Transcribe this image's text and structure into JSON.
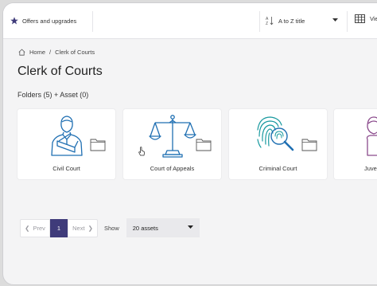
{
  "topbar": {
    "offers_label": "Offers and upgrades",
    "offers_icon": "star-icon",
    "sort_label": "A to Z title",
    "sort_icon": "sort-alpha-icon",
    "view_label": "Vie",
    "view_icon": "grid-view-icon"
  },
  "breadcrumb": {
    "home_label": "Home",
    "separator": "/",
    "current": "Clerk of Courts"
  },
  "page": {
    "title": "Clerk of Courts",
    "counts": "Folders (5) + Asset (0)"
  },
  "folders": [
    {
      "label": "Civil Court",
      "icon": "person-with-arm-sling-icon"
    },
    {
      "label": "Court of Appeals",
      "icon": "scales-of-justice-icon"
    },
    {
      "label": "Criminal Court",
      "icon": "fingerprint-magnifier-icon"
    },
    {
      "label": "Juven",
      "icon": "person-icon"
    }
  ],
  "pagination": {
    "prev_label": "Prev",
    "page": "1",
    "next_label": "Next",
    "show_label": "Show",
    "page_size": "20 assets"
  },
  "colors": {
    "accent": "#3f3b7a",
    "icon_blue": "#1f6fb2",
    "icon_teal": "#1a9aa0",
    "icon_purple": "#8a4a8c"
  }
}
